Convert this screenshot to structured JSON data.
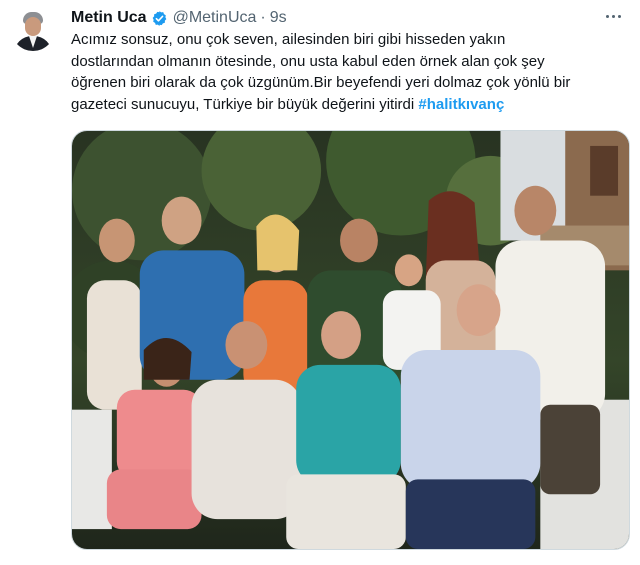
{
  "tweet": {
    "author_name": "Metin Uca",
    "author_handle": "@MetinUca",
    "separator": "·",
    "timestamp": "9s",
    "text_line_1": "Acımız sonsuz, onu çok seven, ailesinden biri gibi hisseden yakın",
    "text_line_2": "dostlarından olmanın ötesinde, onu usta kabul eden örnek alan çok şey",
    "text_line_3": "öğrenen biri olarak da çok üzgünüm.Bir beyefendi yeri dolmaz çok yönlü bir",
    "text_line_4": "gazeteci sunucuyu, Türkiye bir büyük değerini yitirdi ",
    "hashtag": "#halitkıvanç"
  },
  "icons": {
    "verified": "verified-badge-icon",
    "more": "more-options-icon"
  },
  "colors": {
    "accent": "#1d9bf0",
    "text": "#0f1419",
    "secondary_text": "#536471",
    "border": "#cfd9de"
  }
}
